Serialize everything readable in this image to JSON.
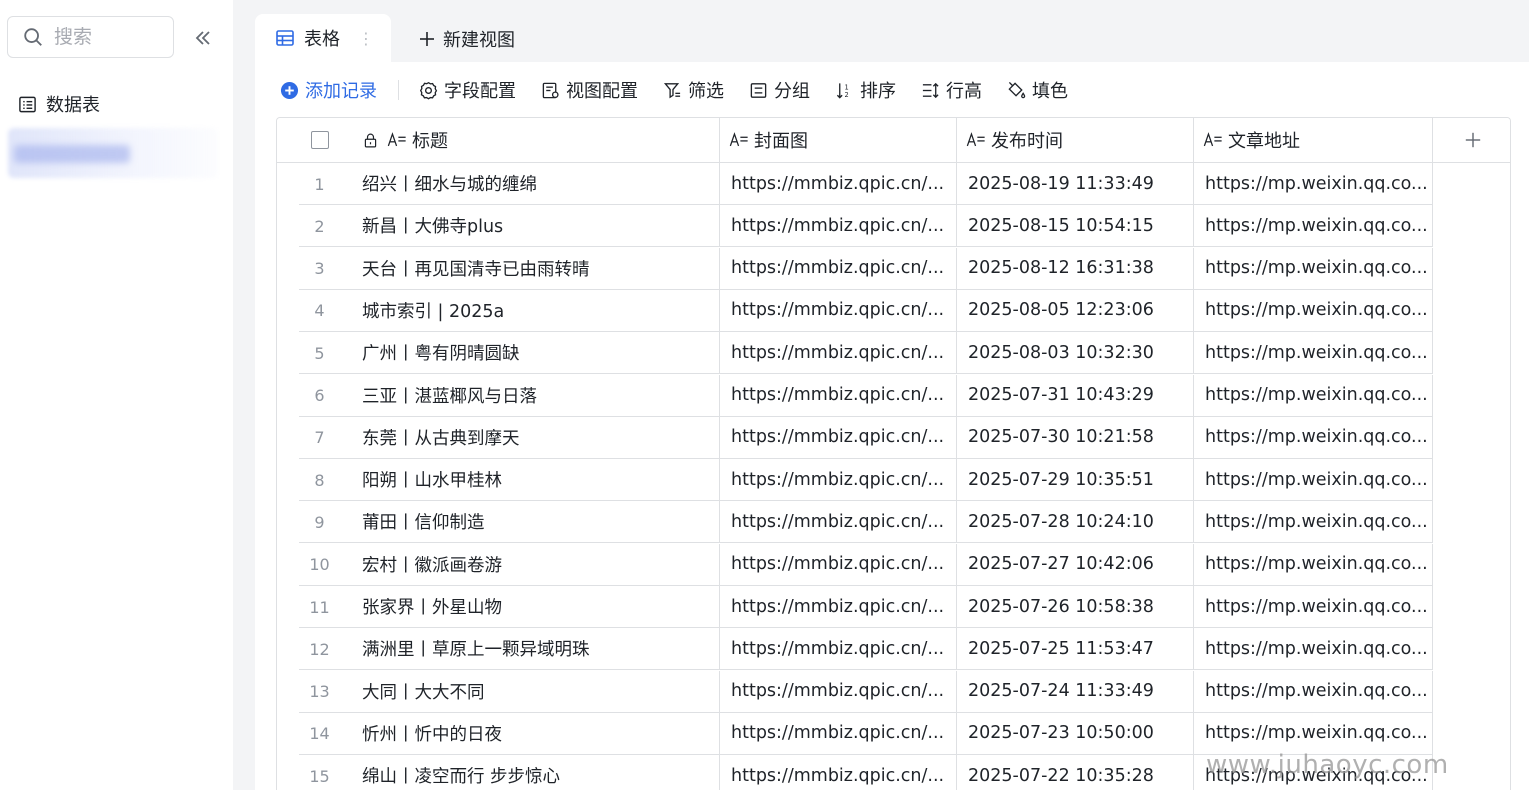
{
  "sidebar": {
    "search_placeholder": "搜索",
    "nav_items": [
      {
        "label": "数据表",
        "icon": "table-list-icon"
      }
    ]
  },
  "tabs": {
    "active_label": "表格",
    "new_view_label": "新建视图"
  },
  "toolbar": {
    "add_record": "添加记录",
    "field_config": "字段配置",
    "view_config": "视图配置",
    "filter": "筛选",
    "group": "分组",
    "sort": "排序",
    "row_height": "行高",
    "fill_color": "填色"
  },
  "table": {
    "columns": [
      "标题",
      "封面图",
      "发布时间",
      "文章地址"
    ],
    "rows": [
      {
        "n": "1",
        "title": "绍兴丨细水与城的缠绵",
        "cover": "https://mmbiz.qpic.cn/...",
        "time": "2025-08-19 11:33:49",
        "url": "https://mp.weixin.qq.co..."
      },
      {
        "n": "2",
        "title": "新昌丨大佛寺plus",
        "cover": "https://mmbiz.qpic.cn/...",
        "time": "2025-08-15 10:54:15",
        "url": "https://mp.weixin.qq.co..."
      },
      {
        "n": "3",
        "title": "天台丨再见国清寺已由雨转晴",
        "cover": "https://mmbiz.qpic.cn/...",
        "time": "2025-08-12 16:31:38",
        "url": "https://mp.weixin.qq.co..."
      },
      {
        "n": "4",
        "title": "城市索引 | 2025a",
        "cover": "https://mmbiz.qpic.cn/...",
        "time": "2025-08-05 12:23:06",
        "url": "https://mp.weixin.qq.co..."
      },
      {
        "n": "5",
        "title": "广州丨粤有阴晴圆缺",
        "cover": "https://mmbiz.qpic.cn/...",
        "time": "2025-08-03 10:32:30",
        "url": "https://mp.weixin.qq.co..."
      },
      {
        "n": "6",
        "title": "三亚丨湛蓝椰风与日落",
        "cover": "https://mmbiz.qpic.cn/...",
        "time": "2025-07-31 10:43:29",
        "url": "https://mp.weixin.qq.co..."
      },
      {
        "n": "7",
        "title": "东莞丨从古典到摩天",
        "cover": "https://mmbiz.qpic.cn/...",
        "time": "2025-07-30 10:21:58",
        "url": "https://mp.weixin.qq.co..."
      },
      {
        "n": "8",
        "title": "阳朔丨山水甲桂林",
        "cover": "https://mmbiz.qpic.cn/...",
        "time": "2025-07-29 10:35:51",
        "url": "https://mp.weixin.qq.co..."
      },
      {
        "n": "9",
        "title": "莆田丨信仰制造",
        "cover": "https://mmbiz.qpic.cn/...",
        "time": "2025-07-28 10:24:10",
        "url": "https://mp.weixin.qq.co..."
      },
      {
        "n": "10",
        "title": "宏村丨徽派画卷游",
        "cover": "https://mmbiz.qpic.cn/...",
        "time": "2025-07-27 10:42:06",
        "url": "https://mp.weixin.qq.co..."
      },
      {
        "n": "11",
        "title": "张家界丨外星山物",
        "cover": "https://mmbiz.qpic.cn/...",
        "time": "2025-07-26 10:58:38",
        "url": "https://mp.weixin.qq.co..."
      },
      {
        "n": "12",
        "title": "满洲里丨草原上一颗异域明珠",
        "cover": "https://mmbiz.qpic.cn/...",
        "time": "2025-07-25 11:53:47",
        "url": "https://mp.weixin.qq.co..."
      },
      {
        "n": "13",
        "title": "大同丨大大不同",
        "cover": "https://mmbiz.qpic.cn/...",
        "time": "2025-07-24 11:33:49",
        "url": "https://mp.weixin.qq.co..."
      },
      {
        "n": "14",
        "title": "忻州丨忻中的日夜",
        "cover": "https://mmbiz.qpic.cn/...",
        "time": "2025-07-23 10:50:00",
        "url": "https://mp.weixin.qq.co..."
      },
      {
        "n": "15",
        "title": "绵山丨凌空而行 步步惊心",
        "cover": "https://mmbiz.qpic.cn/...",
        "time": "2025-07-22 10:35:28",
        "url": "https://mp.weixin.qq.co..."
      }
    ]
  },
  "watermark": "www.juhaoyc.com",
  "colors": {
    "accent": "#2f6be4",
    "border": "#dee0e3",
    "muted": "#8f959e"
  }
}
